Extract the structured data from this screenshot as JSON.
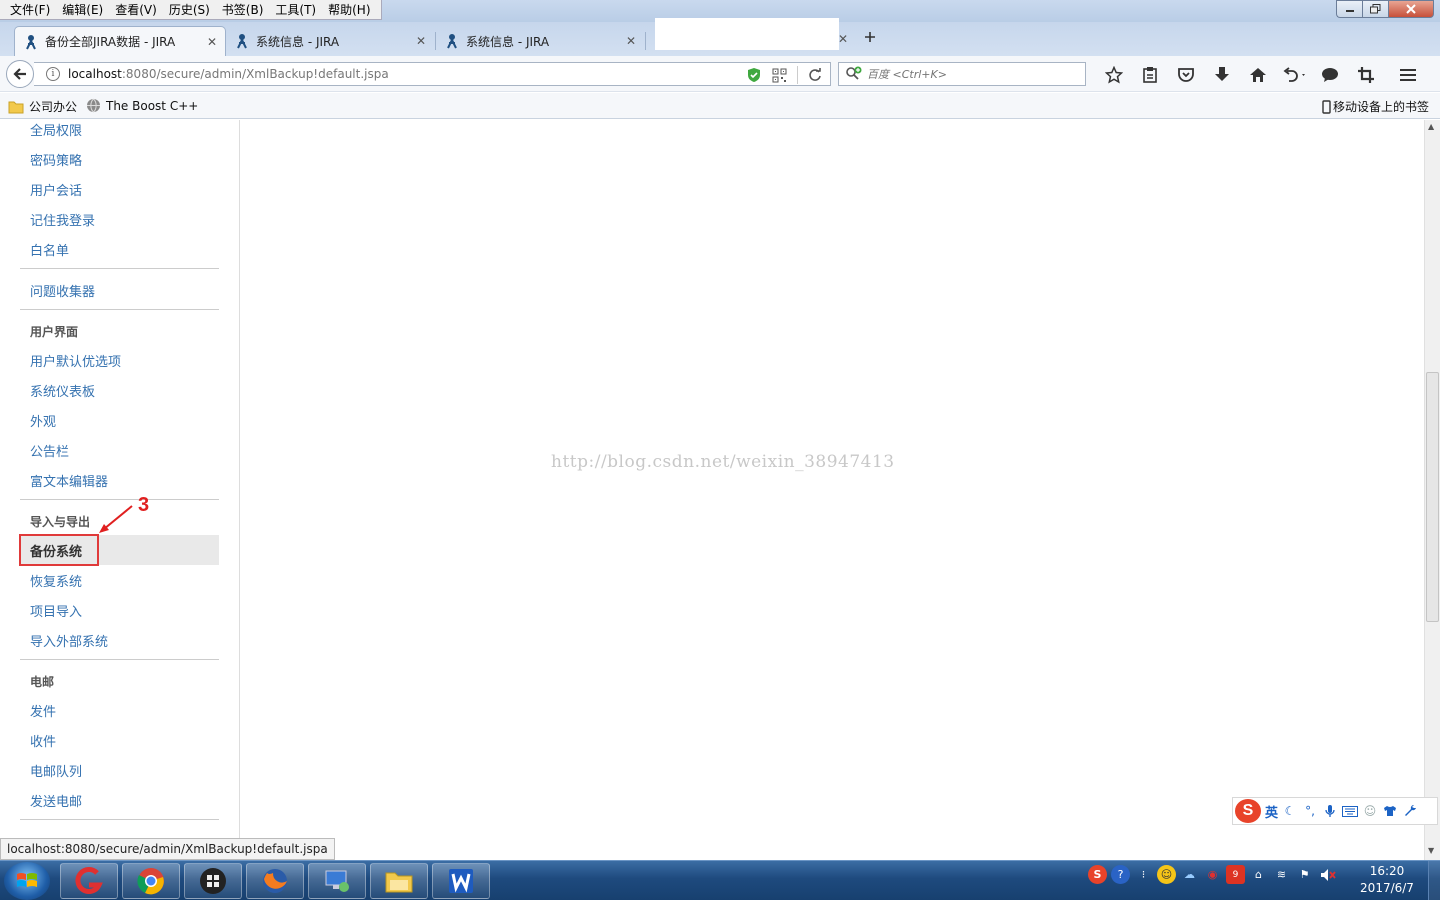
{
  "menu": {
    "items": [
      "文件(F)",
      "编辑(E)",
      "查看(V)",
      "历史(S)",
      "书签(B)",
      "工具(T)",
      "帮助(H)"
    ]
  },
  "tabs": [
    {
      "label": "备份全部JIRA数据 - JIRA",
      "active": true
    },
    {
      "label": "系统信息 - JIRA",
      "active": false
    },
    {
      "label": "系统信息 - JIRA",
      "active": false
    }
  ],
  "address": {
    "host": "localhost",
    "path": ":8080/secure/admin/XmlBackup!default.jspa"
  },
  "search": {
    "placeholder": "百度 <Ctrl+K>"
  },
  "bookmarks": {
    "items": [
      "公司办公",
      "The Boost C++"
    ],
    "mobile": "移动设备上的书签"
  },
  "sidebar": {
    "items": {
      "global_permissions": "全局权限",
      "password_policy": "密码策略",
      "user_sessions": "用户会话",
      "remember_me": "记住我登录",
      "whitelist": "白名单",
      "issue_collectors": "问题收集器",
      "ui_heading": "用户界面",
      "user_defaults": "用户默认优选项",
      "system_dashboard": "系统仪表板",
      "look_and_feel": "外观",
      "announcement_banner": "公告栏",
      "rich_text_editor": "富文本编辑器",
      "import_export_heading": "导入与导出",
      "backup_system": "备份系统",
      "restore_system": "恢复系统",
      "project_import": "项目导入",
      "external_import": "导入外部系统",
      "mail_heading": "电邮",
      "outgoing_mail": "发件",
      "incoming_mail": "收件",
      "mail_queue": "电邮队列",
      "send_email": "发送电邮"
    }
  },
  "annotation": {
    "number": "3",
    "color": "#e02020"
  },
  "watermark": "http://blog.csdn.net/weixin_38947413",
  "status_url": "localhost:8080/secure/admin/XmlBackup!default.jspa",
  "ime": {
    "lang": "英"
  },
  "clock": {
    "time": "16:20",
    "date": "2017/6/7"
  },
  "colors": {
    "link": "#3572b0",
    "highlight": "#e03a3a"
  }
}
